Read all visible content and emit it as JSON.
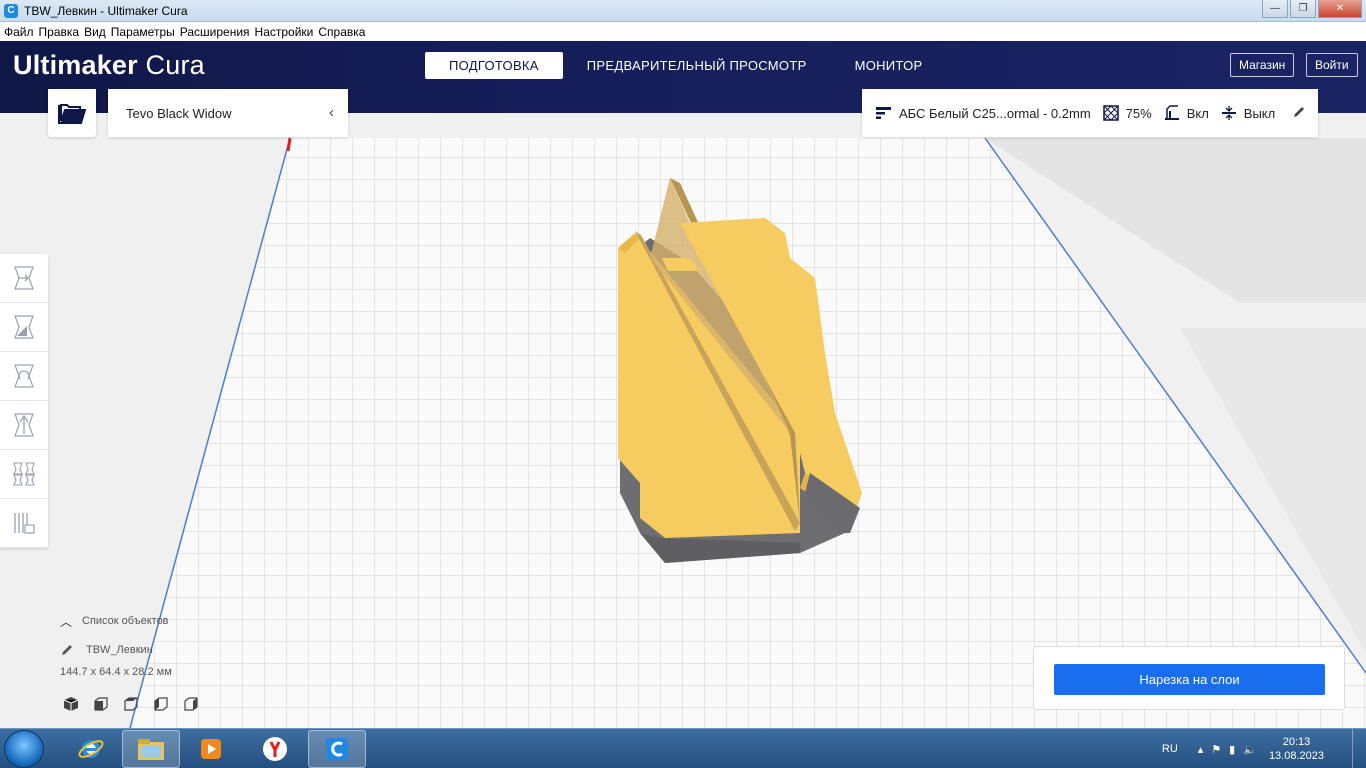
{
  "window": {
    "title": "TBW_Левкин - Ultimaker Cura",
    "buttons": {
      "minimize": "—",
      "maximize": "❐",
      "close": "✕"
    }
  },
  "menu": [
    "Файл",
    "Правка",
    "Вид",
    "Параметры",
    "Расширения",
    "Настройки",
    "Справка"
  ],
  "header": {
    "brand_bold": "Ultimaker",
    "brand_light": " Cura",
    "tabs": [
      {
        "label": "ПОДГОТОВКА",
        "active": true
      },
      {
        "label": "ПРЕДВАРИТЕЛЬНЫЙ ПРОСМОТР",
        "active": false
      },
      {
        "label": "МОНИТОР",
        "active": false
      }
    ],
    "marketplace": "Магазин",
    "signin": "Войти"
  },
  "toolbar": {
    "printer": "Tevo Black Widow",
    "profile": "АБС Белый С25...ormal - 0.2mm",
    "infill": "75%",
    "support": "Вкл",
    "adhesion": "Выкл"
  },
  "objects": {
    "header": "Список объектов",
    "name": "TBW_Левкин",
    "dimensions": "144.7 x 64.4 x 28.2 мм"
  },
  "slice": {
    "button": "Нарезка на слои"
  },
  "taskbar": {
    "language": "RU",
    "time": "20:13",
    "date": "13.08.2023"
  },
  "colors": {
    "header_bg": "#0f1747",
    "accent": "#196ef0",
    "model": "#f5c65a"
  }
}
